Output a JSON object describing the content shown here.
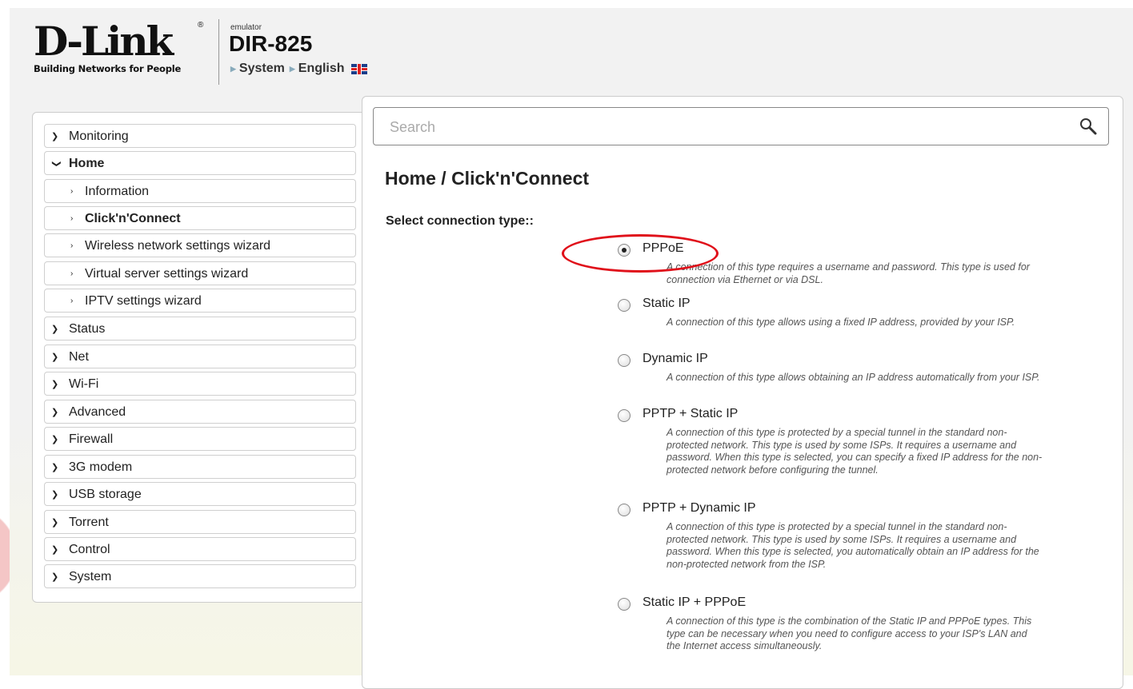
{
  "header": {
    "logo_text": "D-Link",
    "logo_registered": "®",
    "logo_tagline": "Building Networks for People",
    "emulator_label": "emulator",
    "model": "DIR-825",
    "links": [
      "System",
      "English"
    ]
  },
  "sidebar": {
    "items": [
      {
        "label": "Monitoring",
        "level": 0,
        "expanded": false,
        "bold": false
      },
      {
        "label": "Home",
        "level": 0,
        "expanded": true,
        "bold": true
      },
      {
        "label": "Information",
        "level": 1,
        "bold": false
      },
      {
        "label": "Click'n'Connect",
        "level": 1,
        "bold": true
      },
      {
        "label": "Wireless network settings wizard",
        "level": 1,
        "bold": false
      },
      {
        "label": "Virtual server settings wizard",
        "level": 1,
        "bold": false
      },
      {
        "label": "IPTV settings wizard",
        "level": 1,
        "bold": false
      },
      {
        "label": "Status",
        "level": 0,
        "expanded": false,
        "bold": false
      },
      {
        "label": "Net",
        "level": 0,
        "expanded": false,
        "bold": false
      },
      {
        "label": "Wi-Fi",
        "level": 0,
        "expanded": false,
        "bold": false
      },
      {
        "label": "Advanced",
        "level": 0,
        "expanded": false,
        "bold": false
      },
      {
        "label": "Firewall",
        "level": 0,
        "expanded": false,
        "bold": false
      },
      {
        "label": "3G modem",
        "level": 0,
        "expanded": false,
        "bold": false
      },
      {
        "label": "USB storage",
        "level": 0,
        "expanded": false,
        "bold": false
      },
      {
        "label": "Torrent",
        "level": 0,
        "expanded": false,
        "bold": false
      },
      {
        "label": "Control",
        "level": 0,
        "expanded": false,
        "bold": false
      },
      {
        "label": "System",
        "level": 0,
        "expanded": false,
        "bold": false
      }
    ]
  },
  "search": {
    "placeholder": "Search",
    "value": "",
    "icon": "search-icon"
  },
  "main": {
    "breadcrumb": "Home /  Click'n'Connect",
    "section_label": "Select connection type::",
    "options": [
      {
        "label": "PPPoE",
        "checked": true,
        "desc": "A connection of this type requires a username and password. This type is used for connection via Ethernet or via DSL."
      },
      {
        "label": "Static IP",
        "checked": false,
        "desc": "A connection of this type allows using a fixed IP address, provided by your ISP."
      },
      {
        "label": "Dynamic IP",
        "checked": false,
        "desc": "A connection of this type allows obtaining an IP address automatically from your ISP."
      },
      {
        "label": "PPTP + Static IP",
        "checked": false,
        "desc": "A connection of this type is protected by a special tunnel in the standard non-protected network. This type is used by some ISPs. It requires a username and password. When this type is selected, you can specify a fixed IP address for the non-protected network before configuring the tunnel."
      },
      {
        "label": "PPTP + Dynamic IP",
        "checked": false,
        "desc": "A connection of this type is protected by a special tunnel in the standard non-protected network. This type is used by some ISPs. It requires a username and password. When this type is selected, you automatically obtain an IP address for the non-protected network from the ISP."
      },
      {
        "label": "Static IP + PPPoE",
        "checked": false,
        "desc": "A connection of this type is the combination of the Static IP and PPPoE types. This type can be necessary when you need to configure access to your ISP's LAN and the Internet access simultaneously."
      }
    ]
  },
  "colors": {
    "highlight": "#e0101a",
    "page_background": "#f2f2f2"
  }
}
